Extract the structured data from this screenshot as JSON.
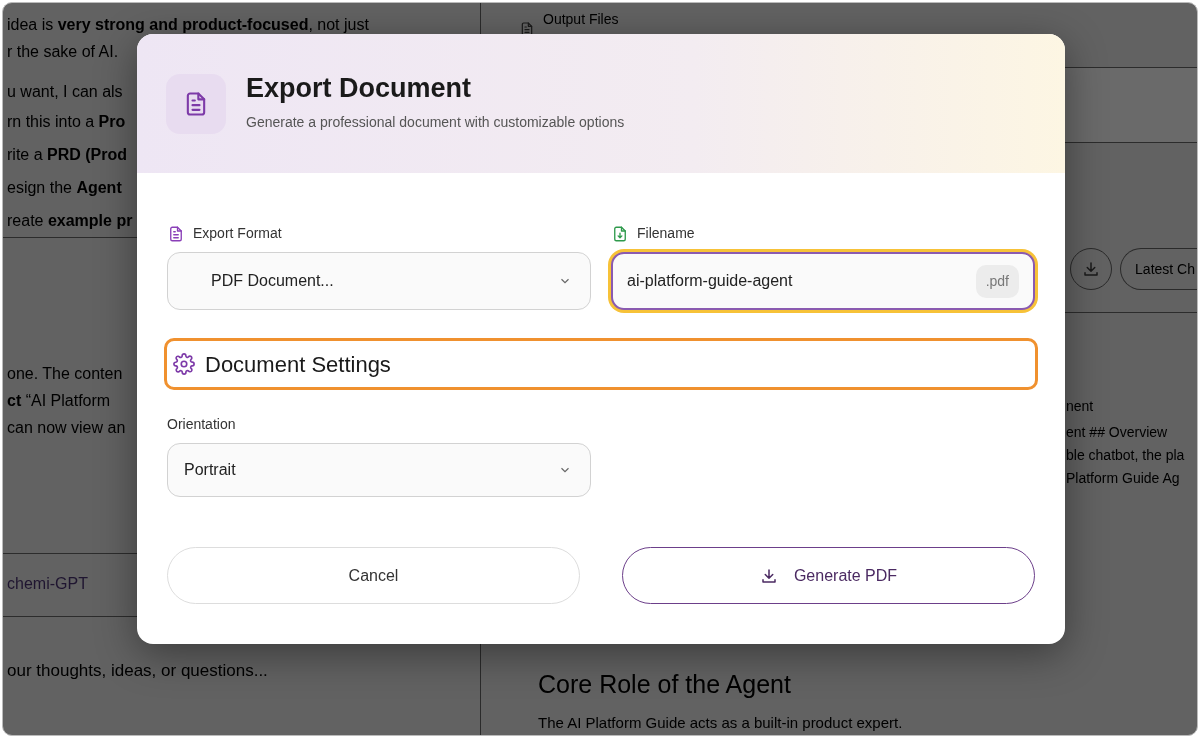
{
  "background": {
    "chat_blocks": [
      {
        "lines": [
          {
            "text": "idea is **very strong and product-focused**, not just",
            "kind": "para"
          },
          {
            "text": "r the sake of AI.",
            "kind": "para"
          },
          {
            "text": "u want, I can als",
            "kind": "gap"
          },
          {
            "text": "rn this into a **Pro**",
            "kind": "item"
          },
          {
            "text": "rite a **PRD (Prod**",
            "kind": "item"
          },
          {
            "text": "esign the **Agent**",
            "kind": "item"
          },
          {
            "text": "reate **example pr**",
            "kind": "item"
          }
        ]
      },
      {
        "lines": [
          {
            "text": "one. The conten",
            "kind": "para"
          },
          {
            "text": "**ct** “AI Platform",
            "kind": "para"
          },
          {
            "text": "can now view an",
            "kind": "para"
          }
        ]
      }
    ],
    "model_label": "chemi-GPT",
    "input_placeholder": "our thoughts, ideas, or questions...",
    "files_panel": {
      "title": "Output Files",
      "latest_button": "Latest Ch",
      "preview_lines": [
        "nent",
        "ent ## Overview",
        "ble chatbot, the pla",
        "Platform Guide Ag"
      ],
      "heading": "Core Role of the Agent",
      "paragraph": "The AI Platform Guide acts as a built-in product expert."
    }
  },
  "dialog": {
    "title": "Export Document",
    "subtitle": "Generate a professional document with customizable options",
    "format": {
      "label": "Export Format",
      "value": "PDF Document..."
    },
    "filename": {
      "label": "Filename",
      "value": "ai-platform-guide-agent",
      "extension": ".pdf",
      "focused": true
    },
    "settings": {
      "title": "Document Settings",
      "highlighted": true
    },
    "orientation": {
      "label": "Orientation",
      "value": "Portrait"
    },
    "buttons": [
      {
        "label": "Cancel",
        "kind": "secondary"
      },
      {
        "label": "Generate PDF",
        "kind": "primary"
      }
    ]
  }
}
